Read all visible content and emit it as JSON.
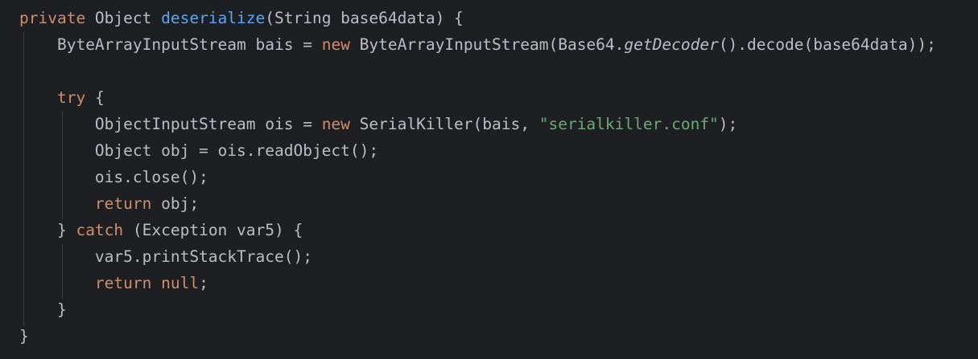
{
  "code": {
    "l1": {
      "kw_private": "private",
      "type_object": " Object ",
      "fn_name": "deserialize",
      "params": "(String base64data) {"
    },
    "l2": {
      "indent": "    ",
      "decl": "ByteArrayInputStream bais = ",
      "kw_new": "new",
      "call_a": " ByteArrayInputStream(Base64.",
      "call_italic": "getDecoder",
      "call_b": "().decode(base64data));"
    },
    "l3": {
      "text": ""
    },
    "l4": {
      "indent": "    ",
      "kw_try": "try",
      "rest": " {"
    },
    "l5": {
      "indent": "        ",
      "decl": "ObjectInputStream ois = ",
      "kw_new": "new",
      "call_a": " SerialKiller(bais, ",
      "str": "\"serialkiller.conf\"",
      "call_b": ");"
    },
    "l6": {
      "indent": "        ",
      "text": "Object obj = ois.readObject();"
    },
    "l7": {
      "indent": "        ",
      "text": "ois.close();"
    },
    "l8": {
      "indent": "        ",
      "kw_return": "return",
      "rest": " obj;"
    },
    "l9": {
      "indent": "    ",
      "brace": "} ",
      "kw_catch": "catch",
      "rest": " (Exception var5) {"
    },
    "l10": {
      "indent": "        ",
      "text": "var5.printStackTrace();"
    },
    "l11": {
      "indent": "        ",
      "kw_return": "return",
      "sp": " ",
      "kw_null": "null",
      "rest": ";"
    },
    "l12": {
      "indent": "    ",
      "text": "}"
    },
    "l13": {
      "text": "}"
    }
  },
  "colors": {
    "background": "#1e1f22",
    "default_text": "#bcbec4",
    "keyword": "#cf8e6d",
    "method_declaration": "#56a8f5",
    "string": "#6aab73",
    "indent_guide": "#393b40"
  }
}
